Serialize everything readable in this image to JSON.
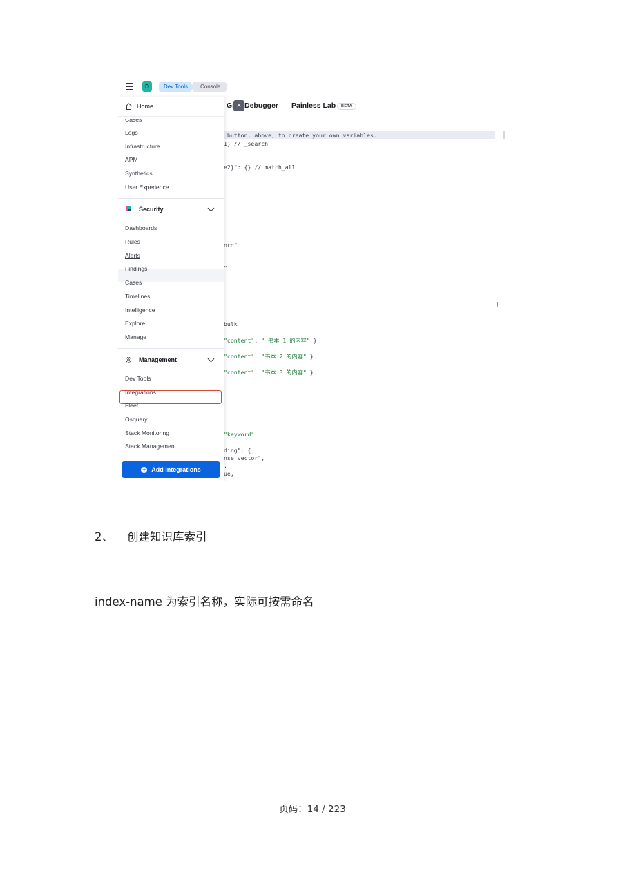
{
  "screenshot": {
    "space_badge": "D",
    "breadcrumbs": [
      "Dev Tools",
      "Console"
    ],
    "tabs": {
      "grok": "Gr",
      "debugger": "Debugger",
      "painless": "Painless Lab",
      "beta": "BETA"
    },
    "close_glyph": "×",
    "nav": {
      "home": "Home",
      "observability_items": [
        "Cases",
        "Logs",
        "Infrastructure",
        "APM",
        "Synthetics",
        "User Experience"
      ],
      "security": {
        "title": "Security",
        "items": [
          "Dashboards",
          "Rules",
          "Alerts",
          "Findings",
          "Cases",
          "Timelines",
          "Intelligence",
          "Explore",
          "Manage"
        ]
      },
      "management": {
        "title": "Management",
        "items": [
          "Dev Tools",
          "Integrations",
          "Fleet",
          "Osquery",
          "Stack Monitoring",
          "Stack Management"
        ]
      },
      "add_integrations": "Add integrations"
    },
    "code_lines": [
      " button, above, to create your own variables.",
      "1} // _search",
      "e2}\": {} // match_all",
      "ord\"",
      "\"",
      "bulk",
      "\"content\": \" 书本 1 的内容\" }",
      "\"content\": \"书本 2 的内容\" }",
      "\"content\": \"书本 3 的内容\" }",
      "\"keyword\"",
      "ding\": {",
      "nse_vector\",",
      ",",
      "ue,"
    ],
    "colors": {
      "accent": "#0b64dd",
      "highlight_box": "#d74937",
      "space_badge": "#20b6a5"
    }
  },
  "document": {
    "heading_number": "2、",
    "heading_text": "创建知识库索引",
    "paragraph": "index-name 为索引名称，实际可按需命名",
    "footer": "页码：14 / 223"
  }
}
